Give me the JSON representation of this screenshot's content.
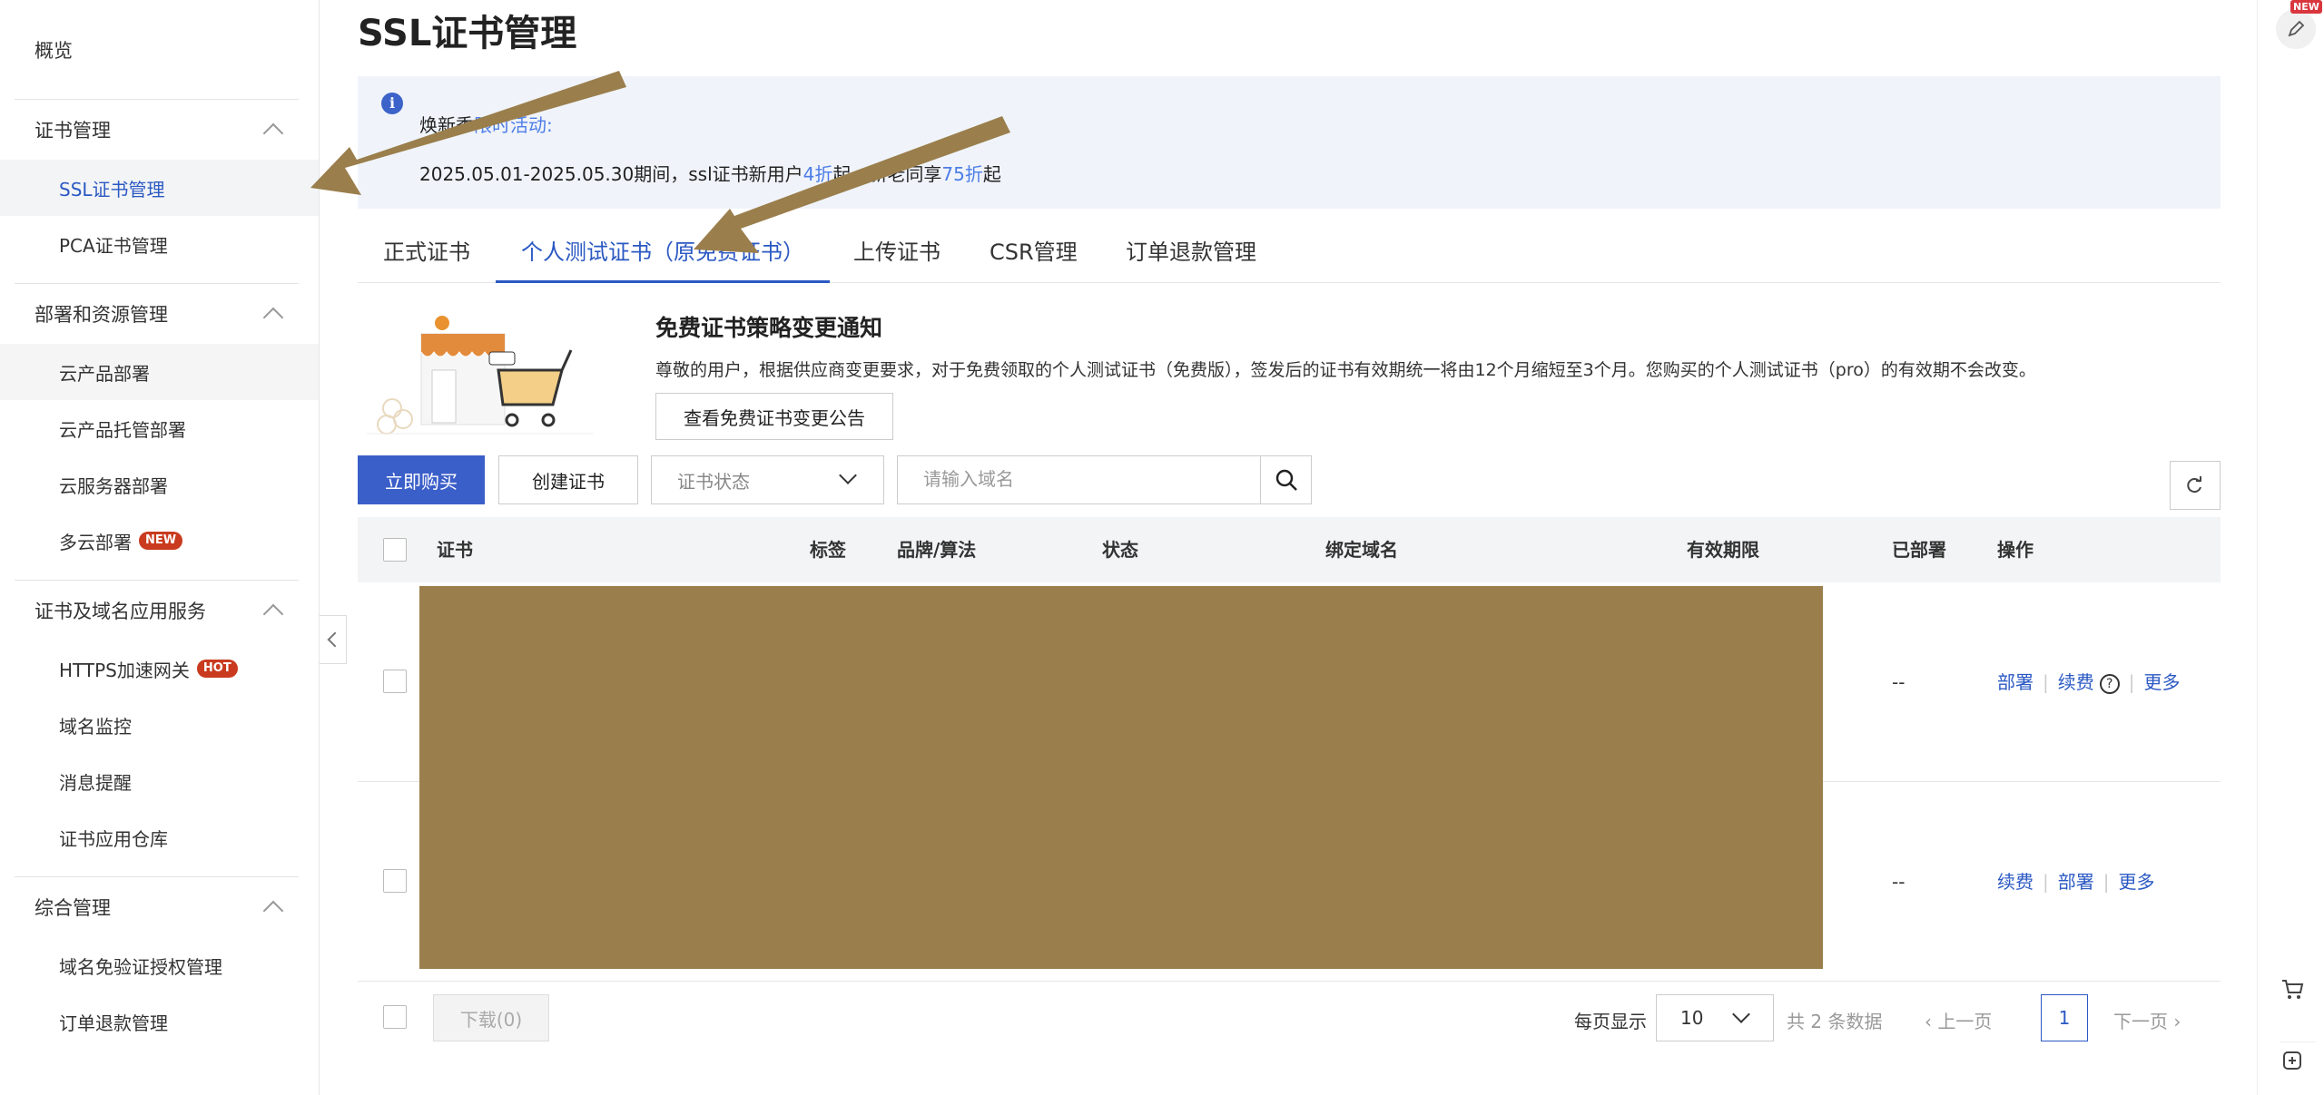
{
  "sidebar": {
    "overview": "概览",
    "groups": [
      {
        "title": "证书管理",
        "items": [
          "SSL证书管理",
          "PCA证书管理"
        ]
      },
      {
        "title": "部署和资源管理",
        "items": [
          "云产品部署",
          "云产品托管部署",
          "云服务器部署",
          "多云部署"
        ]
      },
      {
        "title": "证书及域名应用服务",
        "items": [
          "HTTPS加速网关",
          "域名监控",
          "消息提醒",
          "证书应用仓库"
        ]
      },
      {
        "title": "综合管理",
        "items": [
          "域名免验证授权管理",
          "订单退款管理"
        ]
      }
    ],
    "badges": {
      "multicloud": "NEW",
      "https": "HOT"
    }
  },
  "main": {
    "title": "SSL证书管理",
    "notice": {
      "prefix": "焕新季",
      "link": "限时活动:",
      "line2_a": "2025.05.01-2025.05.30期间，ssl证书新用户",
      "hl1": "4折",
      "line2_b": "起，新老同享",
      "hl2": "75折",
      "line2_c": "起"
    },
    "tabs": [
      "正式证书",
      "个人测试证书（原免费证书）",
      "上传证书",
      "CSR管理",
      "订单退款管理"
    ],
    "promo": {
      "title": "免费证书策略变更通知",
      "desc": "尊敬的用户，根据供应商变更要求，对于免费领取的个人测试证书（免费版），签发后的证书有效期统一将由12个月缩短至3个月。您购买的个人测试证书（pro）的有效期不会改变。",
      "button": "查看免费证书变更公告"
    },
    "toolbar": {
      "buy": "立即购买",
      "create": "创建证书",
      "status_placeholder": "证书状态",
      "search_placeholder": "请输入域名"
    },
    "table": {
      "headers": [
        "证书",
        "标签",
        "品牌/算法",
        "状态",
        "绑定域名",
        "有效期限",
        "已部署",
        "操作"
      ],
      "rows": [
        {
          "deployed": "--",
          "actions": [
            "部署",
            "续费",
            "更多"
          ]
        },
        {
          "deployed": "--",
          "actions": [
            "续费",
            "部署",
            "更多"
          ]
        }
      ]
    },
    "footer": {
      "download": "下载(0)",
      "per_page_label": "每页显示",
      "per_page": "10",
      "total": "共 2 条数据",
      "prev": "上一页",
      "current": "1",
      "next": "下一页"
    }
  },
  "rail": {
    "new": "NEW"
  },
  "colors": {
    "accent": "#2b59c3",
    "primary_button": "#3b5fc9",
    "redaction": "#9a7e4c",
    "arrow": "#9a7e4c"
  }
}
